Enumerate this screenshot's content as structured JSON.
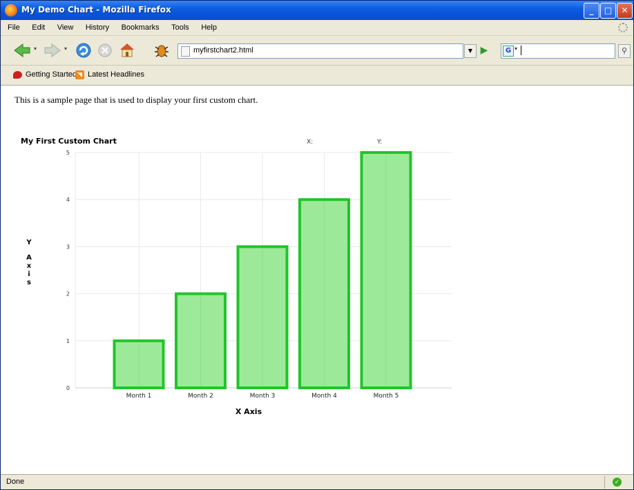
{
  "window": {
    "title": "My Demo Chart - Mozilla Firefox",
    "buttons": [
      "minimize",
      "maximize",
      "close"
    ]
  },
  "menu": [
    "File",
    "Edit",
    "View",
    "History",
    "Bookmarks",
    "Tools",
    "Help"
  ],
  "toolbar": {
    "url": "myfirstchart2.html",
    "search_value": ""
  },
  "bookmarks": [
    "Getting Started",
    "Latest Headlines"
  ],
  "page": {
    "intro": "This is a sample page that is used to display your first custom chart."
  },
  "chart_data": {
    "type": "bar",
    "title": "My First Custom Chart",
    "header_labels": [
      "X:",
      "Y:"
    ],
    "categories": [
      "Month 1",
      "Month 2",
      "Month 3",
      "Month 4",
      "Month 5"
    ],
    "values": [
      1,
      2,
      3,
      4,
      5
    ],
    "xlabel": "X Axis",
    "ylabel": "Y Axis",
    "ylim": [
      0,
      5
    ],
    "yticks": [
      "0",
      "1",
      "2",
      "3",
      "4",
      "5"
    ],
    "grid": true,
    "colors": {
      "fill": "#9de99a",
      "stroke": "#22c42a",
      "grid": "#e8e8e8"
    }
  },
  "status": {
    "text": "Done"
  }
}
